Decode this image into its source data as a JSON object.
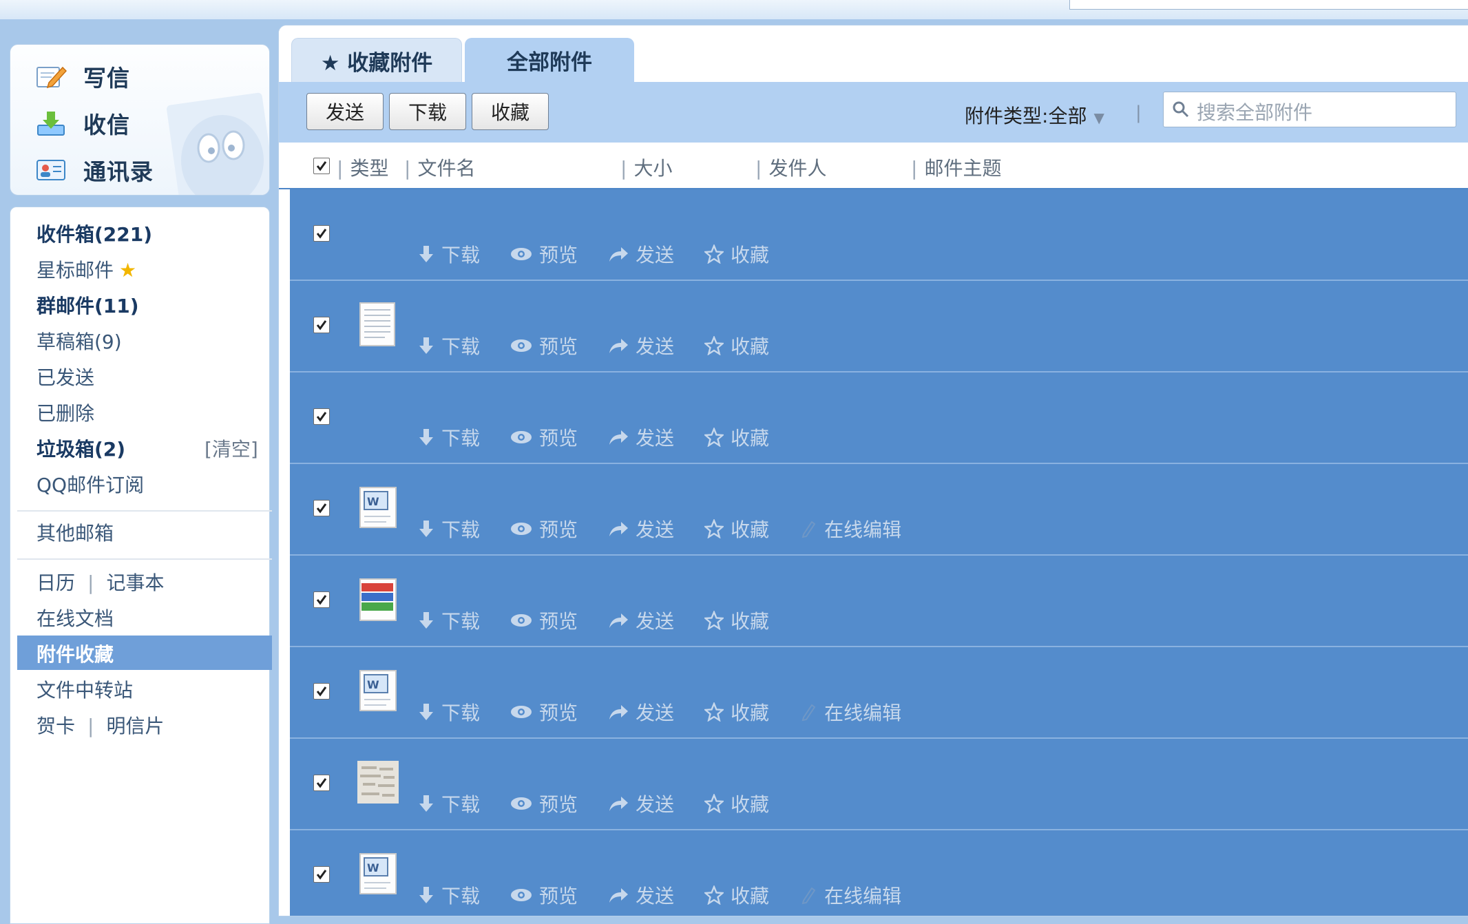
{
  "quick": {
    "compose": "写信",
    "inbox": "收信",
    "contacts": "通讯录"
  },
  "folders": {
    "inbox": "收件箱(221)",
    "starred": "星标邮件",
    "group": "群邮件(11)",
    "drafts": "草稿箱(9)",
    "sent": "已发送",
    "deleted": "已删除",
    "spam": "垃圾箱(2)",
    "spam_clear": "[清空]",
    "subscribe": "QQ邮件订阅",
    "other": "其他邮箱",
    "calendar": "日历",
    "notes": "记事本",
    "docs": "在线文档",
    "attach_fav": "附件收藏",
    "transfer": "文件中转站",
    "card": "贺卡",
    "postcard": "明信片"
  },
  "tabs": {
    "fav": "★ 收藏附件",
    "all": "全部附件"
  },
  "toolbar": {
    "send": "发送",
    "download": "下载",
    "favorite": "收藏",
    "filter_label": "附件类型:",
    "filter_value": "全部",
    "search_placeholder": "搜索全部附件"
  },
  "columns": {
    "type": "类型",
    "filename": "文件名",
    "size": "大小",
    "sender": "发件人",
    "subject": "邮件主题"
  },
  "actions": {
    "download": "下载",
    "preview": "预览",
    "send": "发送",
    "favorite": "收藏",
    "edit": "在线编辑"
  },
  "rows": [
    {
      "icon": "none",
      "editable": false,
      "checked": true
    },
    {
      "icon": "text-document",
      "editable": false,
      "checked": true
    },
    {
      "icon": "none",
      "editable": false,
      "checked": true
    },
    {
      "icon": "word-document",
      "editable": true,
      "checked": true
    },
    {
      "icon": "archive-rar",
      "editable": false,
      "checked": true
    },
    {
      "icon": "word-document",
      "editable": true,
      "checked": true
    },
    {
      "icon": "image-thumbnail",
      "editable": false,
      "checked": true
    },
    {
      "icon": "word-document",
      "editable": true,
      "checked": true
    }
  ],
  "colors": {
    "row_selected": "#548ccc",
    "active_folder": "#6f9fd9",
    "toolbar": "#b2d0f2"
  }
}
